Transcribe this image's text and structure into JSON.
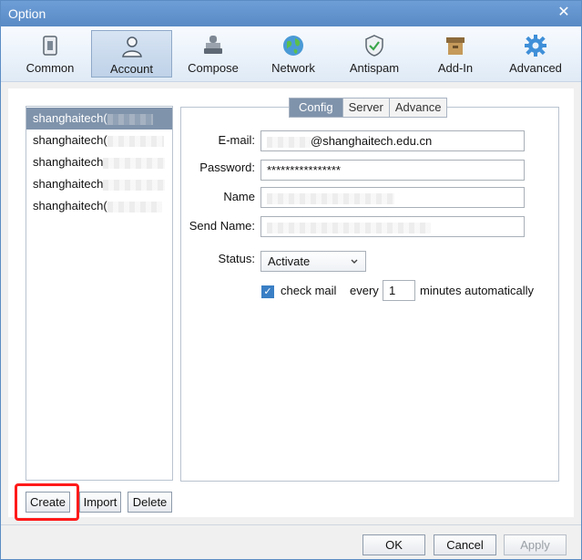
{
  "window": {
    "title": "Option",
    "close_label": "✕"
  },
  "toolbar": {
    "items": [
      {
        "label": "Common"
      },
      {
        "label": "Account"
      },
      {
        "label": "Compose"
      },
      {
        "label": "Network"
      },
      {
        "label": "Antispam"
      },
      {
        "label": "Add-In"
      },
      {
        "label": "Advanced"
      }
    ],
    "active": "Account"
  },
  "accounts": {
    "items": [
      {
        "label": "shanghaitech("
      },
      {
        "label": "shanghaitech("
      },
      {
        "label": "shanghaitech"
      },
      {
        "label": "shanghaitech"
      },
      {
        "label": "shanghaitech("
      }
    ],
    "selected_index": 0
  },
  "tabs": {
    "items": [
      {
        "label": "Config"
      },
      {
        "label": "Server"
      },
      {
        "label": "Advance"
      }
    ],
    "active": "Config"
  },
  "form": {
    "email_label": "E-mail:",
    "email_value": "@shanghaitech.edu.cn",
    "password_label": "Password:",
    "password_value": "****************",
    "name_label": "Name",
    "send_name_label": "Send Name:",
    "status_label": "Status:",
    "status_value": "Activate",
    "check_mail_label": "check mail",
    "every_label": "every",
    "interval_value": "1",
    "minutes_label": "minutes automatically",
    "check_mail_checked": true
  },
  "list_buttons": {
    "create": "Create",
    "import": "Import",
    "delete": "Delete"
  },
  "footer": {
    "ok": "OK",
    "cancel": "Cancel",
    "apply": "Apply"
  },
  "colors": {
    "titlebar": "#5a8ac5",
    "selection": "#7f93ab",
    "highlight": "#ff1a1a",
    "checkbox": "#3a7fc5"
  }
}
